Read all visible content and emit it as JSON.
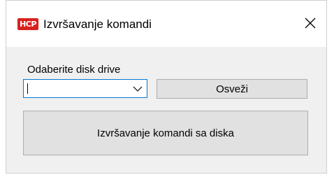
{
  "window": {
    "title": "Izvršavanje komandi",
    "icon": {
      "name": "hcp-app-icon",
      "text": "HCP",
      "color": "#d8211d"
    },
    "close_icon": "close-icon"
  },
  "form": {
    "drive_label": "Odaberite disk drive",
    "drive_select": {
      "value": "",
      "arrow_icon": "chevron-down-icon"
    },
    "refresh_button": "Osveži",
    "run_button": "Izvršavanje komandi sa diska"
  },
  "colors": {
    "accent_focus": "#0078d7",
    "window_bg": "#f0f0f0",
    "button_bg": "#e1e1e1"
  }
}
